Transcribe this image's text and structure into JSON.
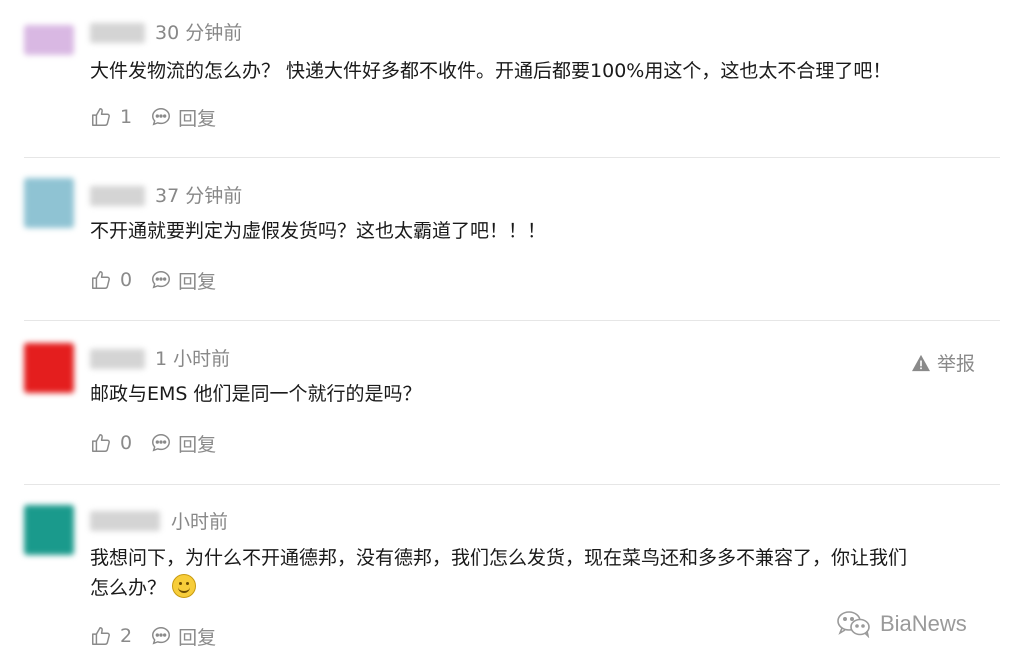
{
  "comments": [
    {
      "time": "30 分钟前",
      "text": "大件发物流的怎么办？ 快递大件好多都不收件。开通后都要100%用这个，这也太不合理了吧！",
      "likes": "1",
      "reply_label": "回复",
      "avatar_color": "#d9b8e3"
    },
    {
      "time": "37 分钟前",
      "text": "不开通就要判定为虚假发货吗？这也太霸道了吧！！！",
      "likes": "0",
      "reply_label": "回复",
      "avatar_color": "#8fc3d3"
    },
    {
      "time": "1 小时前",
      "text": "邮政与EMS 他们是同一个就行的是吗？",
      "likes": "0",
      "reply_label": "回复",
      "report_label": "举报",
      "avatar_color": "#e41e1e"
    },
    {
      "time": "小时前",
      "text_line1": "我想问下，为什么不开通德邦，没有德邦，我们怎么发货，现在菜鸟还和多多不兼容了，你让我们",
      "text_line2": "怎么办？",
      "likes": "2",
      "reply_label": "回复",
      "avatar_color": "#1a9a8c"
    }
  ],
  "icons": {
    "like": "thumbs-up-icon",
    "reply": "speech-bubble-icon",
    "report": "warning-triangle-icon",
    "emoji": "smiling-face-emoji",
    "watermark": "wechat-icon"
  },
  "watermark": {
    "text": "BiaNews"
  }
}
